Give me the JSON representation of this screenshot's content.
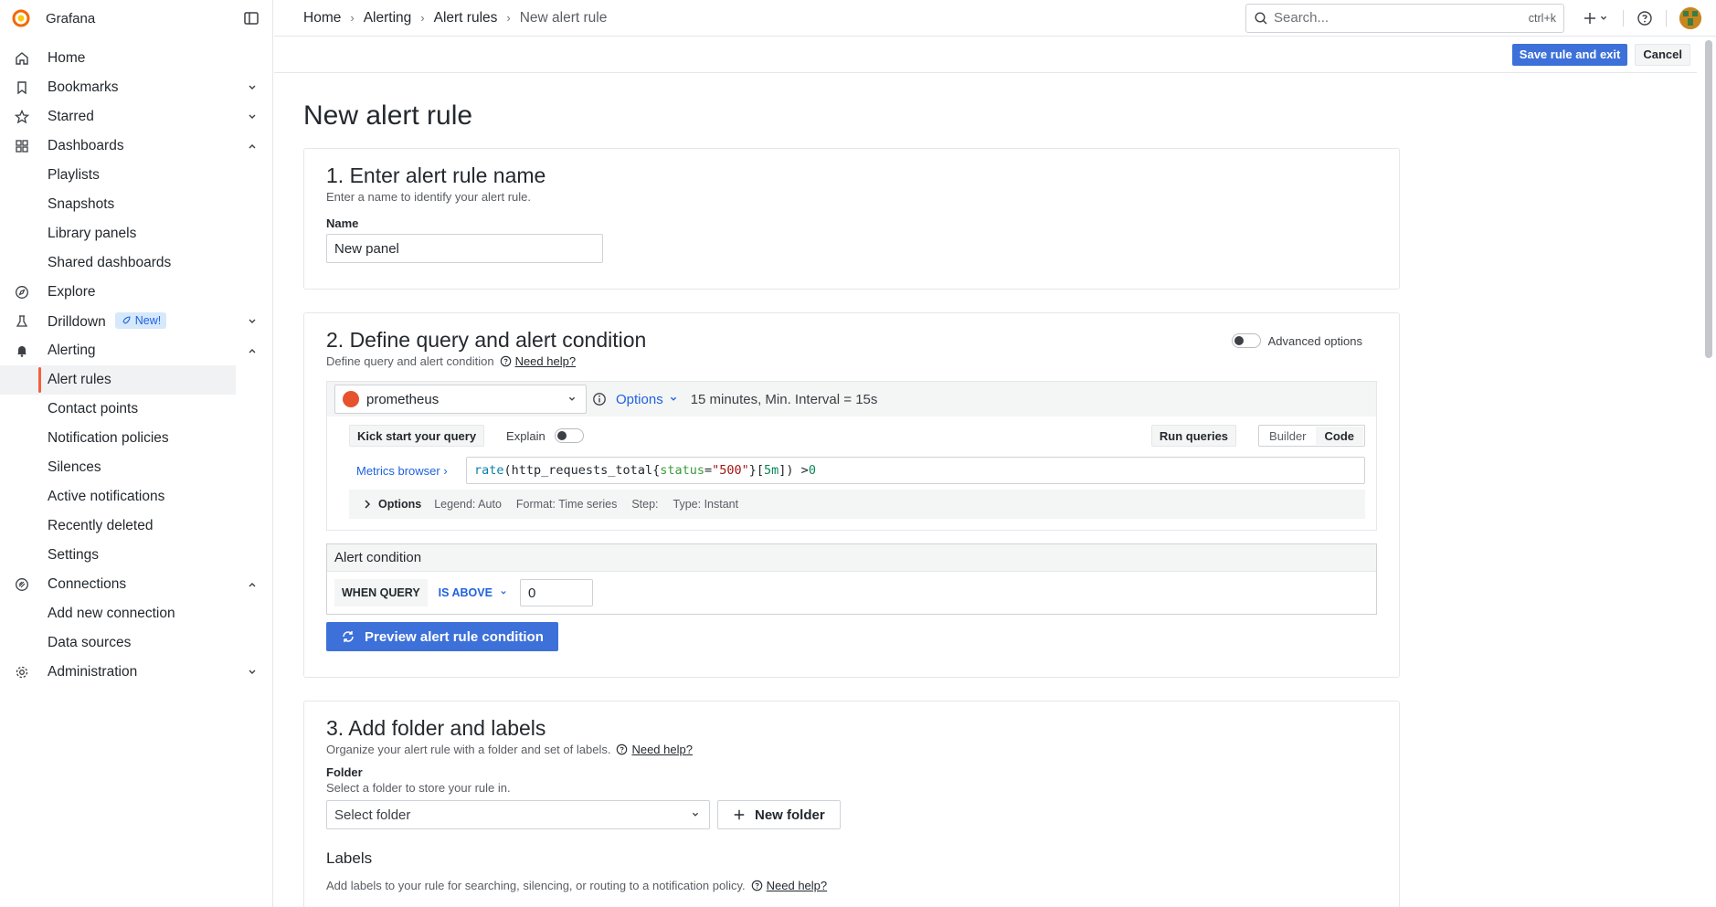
{
  "app": {
    "brand": "Grafana"
  },
  "sidebar": {
    "items": [
      {
        "label": "Home",
        "icon": "home-icon"
      },
      {
        "label": "Bookmarks",
        "icon": "bookmark-icon"
      },
      {
        "label": "Starred",
        "icon": "star-icon"
      },
      {
        "label": "Dashboards",
        "icon": "apps-icon"
      },
      {
        "label": "Playlists"
      },
      {
        "label": "Snapshots"
      },
      {
        "label": "Library panels"
      },
      {
        "label": "Shared dashboards"
      },
      {
        "label": "Explore",
        "icon": "compass-icon"
      },
      {
        "label": "Drilldown",
        "icon": "drilldown-icon",
        "badge": "New!"
      },
      {
        "label": "Alerting",
        "icon": "bell-icon"
      },
      {
        "label": "Alert rules"
      },
      {
        "label": "Contact points"
      },
      {
        "label": "Notification policies"
      },
      {
        "label": "Silences"
      },
      {
        "label": "Active notifications"
      },
      {
        "label": "Recently deleted"
      },
      {
        "label": "Settings"
      },
      {
        "label": "Connections",
        "icon": "link-icon"
      },
      {
        "label": "Add new connection"
      },
      {
        "label": "Data sources"
      },
      {
        "label": "Administration",
        "icon": "gear-icon"
      }
    ]
  },
  "topbar": {
    "breadcrumbs": [
      "Home",
      "Alerting",
      "Alert rules",
      "New alert rule"
    ],
    "search_placeholder": "Search...",
    "search_shortcut": "ctrl+k"
  },
  "actions": {
    "save": "Save rule and exit",
    "cancel": "Cancel"
  },
  "page": {
    "title": "New alert rule"
  },
  "section1": {
    "title": "1. Enter alert rule name",
    "desc": "Enter a name to identify your alert rule.",
    "name_label": "Name",
    "name_value": "New panel"
  },
  "section2": {
    "title": "2. Define query and alert condition",
    "desc": "Define query and alert condition",
    "help": "Need help?",
    "advanced": "Advanced options",
    "datasource": "prometheus",
    "options": "Options",
    "interval": "15 minutes, Min. Interval = 15s",
    "kickstart": "Kick start your query",
    "explain": "Explain",
    "run": "Run queries",
    "builder": "Builder",
    "code": "Code",
    "metrics_browser": "Metrics browser",
    "query": {
      "fn": "rate",
      "p1": "(http_requests_total{",
      "label": "status",
      "eq": "=",
      "str": "\"500\"",
      "p2": "}[",
      "dur": "5m",
      "p3": "]) > ",
      "num": "0"
    },
    "opts_label": "Options",
    "legend": "Legend: Auto",
    "format": "Format: Time series",
    "step": "Step:",
    "type": "Type: Instant",
    "condition_title": "Alert condition",
    "when_query": "WHEN QUERY",
    "is_above": "IS ABOVE",
    "threshold": "0",
    "preview": "Preview alert rule condition"
  },
  "section3": {
    "title": "3. Add folder and labels",
    "desc": "Organize your alert rule with a folder and set of labels.",
    "help": "Need help?",
    "folder_label": "Folder",
    "folder_sub": "Select a folder to store your rule in.",
    "folder_placeholder": "Select folder",
    "new_folder": "New folder",
    "labels_title": "Labels",
    "labels_desc": "Add labels to your rule for searching, silencing, or routing to a notification policy.",
    "labels_help": "Need help?"
  }
}
